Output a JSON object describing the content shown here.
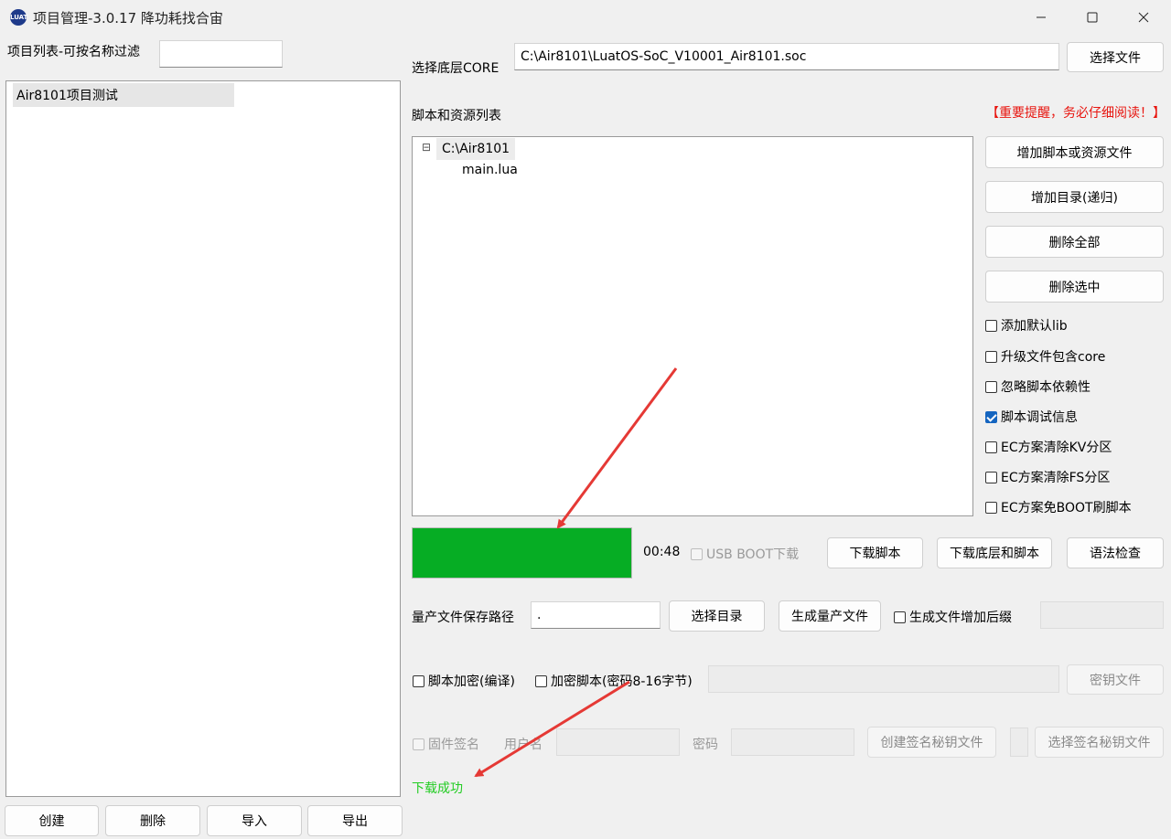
{
  "window": {
    "icon_text": "LUAT",
    "title": "项目管理-3.0.17 降功耗找合宙"
  },
  "left": {
    "filter_label": "项目列表-可按名称过滤",
    "filter_value": "",
    "projects": [
      "Air8101项目测试"
    ],
    "buttons": {
      "create": "创建",
      "delete": "删除",
      "import": "导入",
      "export": "导出"
    }
  },
  "core": {
    "label": "选择底层CORE",
    "path": "C:\\Air8101\\LuatOS-SoC_V10001_Air8101.soc",
    "select_button": "选择文件"
  },
  "scripts": {
    "label": "脚本和资源列表",
    "warning": "【重要提醒，务必仔细阅读！】",
    "tree": {
      "root": "C:\\Air8101",
      "root_toggle": "⊟",
      "children": [
        "main.lua"
      ]
    },
    "side_buttons": {
      "add_file": "增加脚本或资源文件",
      "add_dir": "增加目录(递归)",
      "delete_all": "删除全部",
      "delete_selected": "删除选中"
    },
    "options": [
      {
        "label": "添加默认lib",
        "checked": false
      },
      {
        "label": "升级文件包含core",
        "checked": false
      },
      {
        "label": "忽略脚本依赖性",
        "checked": false
      },
      {
        "label": "脚本调试信息",
        "checked": true
      },
      {
        "label": "EC方案清除KV分区",
        "checked": false
      },
      {
        "label": "EC方案清除FS分区",
        "checked": false
      },
      {
        "label": "EC方案免BOOT刷脚本",
        "checked": false
      }
    ]
  },
  "download": {
    "progress": 1.0,
    "progress_color": "#06ad24",
    "time": "00:48",
    "usb_boot_label": "USB BOOT下载",
    "download_script": "下载脚本",
    "download_core_and_script": "下载底层和脚本",
    "syntax_check": "语法检查"
  },
  "mass": {
    "label": "量产文件保存路径",
    "path_value": ".",
    "select_dir": "选择目录",
    "generate": "生成量产文件",
    "suffix_label": "生成文件增加后缀",
    "suffix_value": ""
  },
  "encrypt": {
    "script_encrypt": "脚本加密(编译)",
    "password_encrypt": "加密脚本(密码8-16字节)",
    "password_value": "",
    "key_file_button": "密钥文件"
  },
  "sign": {
    "firmware_sign": "固件签名",
    "username_label": "用户名",
    "password_label": "密码",
    "create_key_button": "创建签名秘钥文件",
    "select_key_button": "选择签名秘钥文件"
  },
  "status": {
    "text": "下载成功",
    "color": "#22cc22"
  },
  "annotation": {
    "arrow_color": "#e53935"
  }
}
